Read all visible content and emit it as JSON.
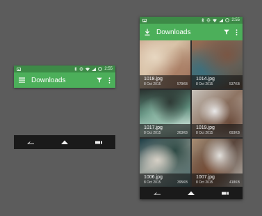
{
  "status_bar": {
    "time": "2:55",
    "signal_icon": "image-notification-icon",
    "right_icons": [
      "bluetooth-icon",
      "vibrate-icon",
      "wifi-icon",
      "signal-icon",
      "battery-icon"
    ]
  },
  "app_bar": {
    "title": "Downloads",
    "menu_icon": "hamburger-menu-icon",
    "drawer_icon": "downloads-icon",
    "filter_icon": "filter-icon",
    "overflow_icon": "more-vert-icon"
  },
  "navigation": {
    "back_icon": "back-icon",
    "home_icon": "home-icon",
    "recents_icon": "recents-icon"
  },
  "files": [
    {
      "name": "1018.jpg",
      "date": "8 Oct 2015",
      "size": "579KB"
    },
    {
      "name": "1014.jpg",
      "date": "8 Oct 2015",
      "size": "537KB"
    },
    {
      "name": "1017.jpg",
      "date": "8 Oct 2015",
      "size": "263KB"
    },
    {
      "name": "1019.jpg",
      "date": "8 Oct 2015",
      "size": "693KB"
    },
    {
      "name": "1006.jpg",
      "date": "8 Oct 2015",
      "size": "395KB"
    },
    {
      "name": "1007.jpg",
      "date": "8 Oct 2015",
      "size": "418KB"
    }
  ],
  "colors": {
    "background": "#5c5c5c",
    "primary": "#4caf5a",
    "primary_dark": "#3d8a47",
    "nav_bar": "#1a1a1a"
  }
}
